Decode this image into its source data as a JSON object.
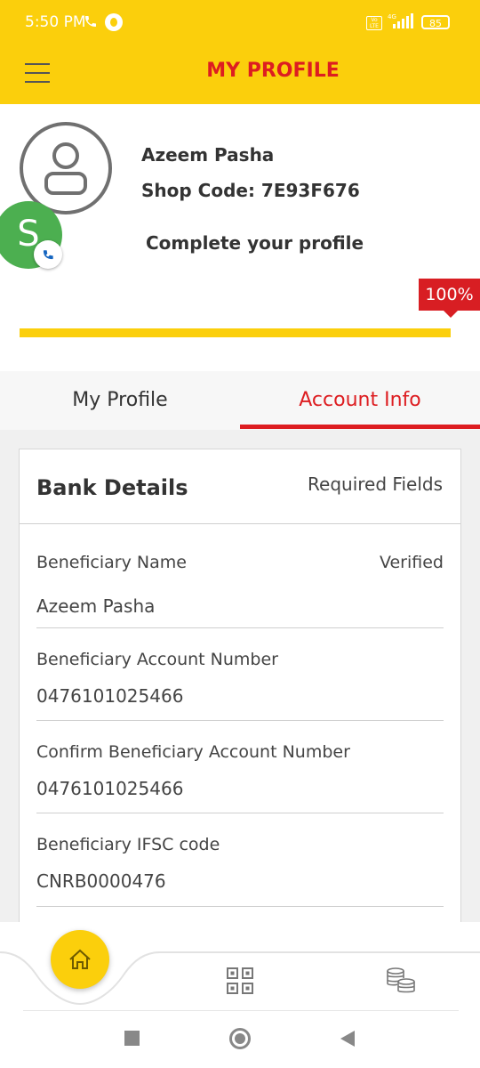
{
  "status_bar": {
    "time": "5:50 PM",
    "network": "4G",
    "lte_label": "Vo LTE",
    "battery": "85",
    "icons": [
      "phone-call-icon",
      "whatsapp-icon",
      "volte-icon",
      "signal-icon",
      "battery-icon"
    ]
  },
  "app_bar": {
    "title": "MY PROFILE",
    "menu_icon": "hamburger-menu-icon"
  },
  "profile": {
    "name": "Azeem Pasha",
    "shop_code": "Shop Code: 7E93F676",
    "complete_prompt": "Complete your profile",
    "completion_label": "100%",
    "completion_fraction": 1.0,
    "chat_head_letter": "S"
  },
  "tabs": [
    {
      "label": "My Profile",
      "active": false
    },
    {
      "label": "Account Info",
      "active": true
    }
  ],
  "bank_details": {
    "title": "Bank Details",
    "required_label": "Required Fields",
    "fields": [
      {
        "label": "Beneficiary Name",
        "value": "Azeem Pasha",
        "status": "Verified"
      },
      {
        "label": "Beneficiary Account Number",
        "value": "0476101025466"
      },
      {
        "label": "Confirm Beneficiary Account Number",
        "value": "0476101025466"
      },
      {
        "label": "Beneficiary IFSC code",
        "value": "CNRB0000476"
      }
    ]
  },
  "bottom_nav": {
    "items": [
      "home-icon",
      "qr-code-icon",
      "coins-icon"
    ],
    "active": "home-icon"
  },
  "colors": {
    "brand_yellow": "#fbcf0c",
    "brand_red": "#dd1d21",
    "chat_head_green": "#4caf50"
  }
}
